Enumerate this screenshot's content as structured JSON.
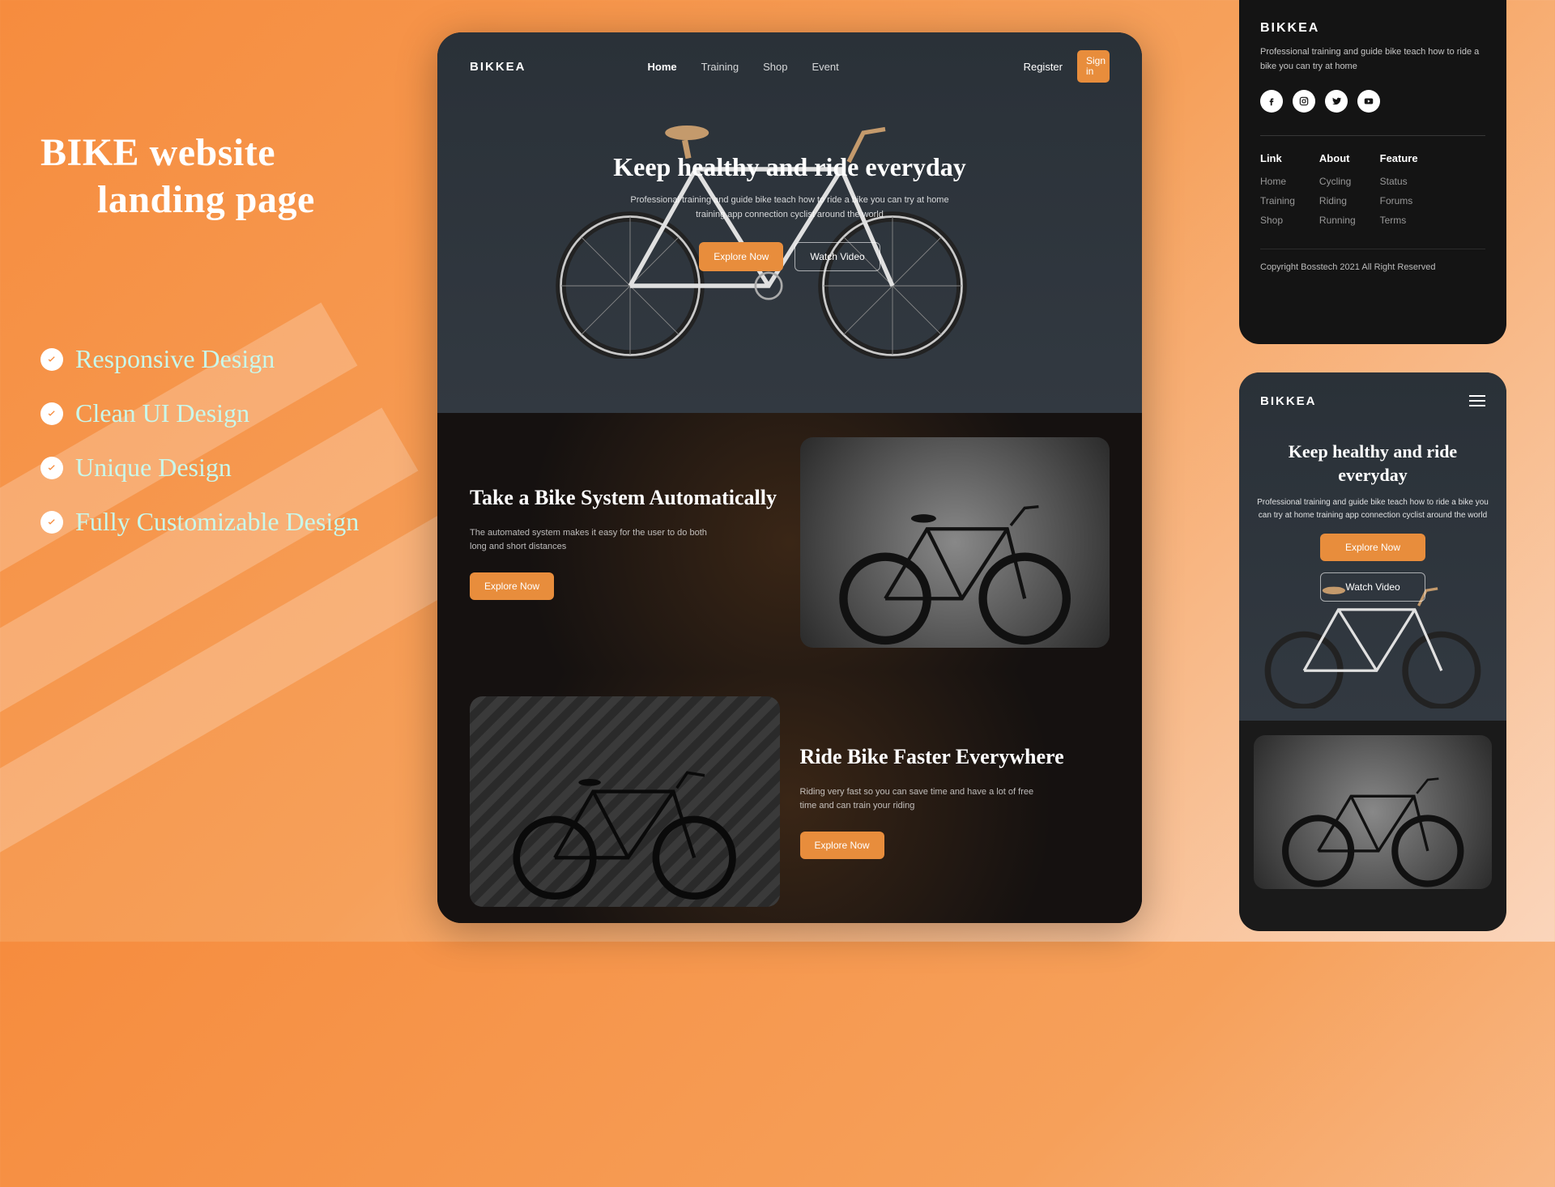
{
  "promo": {
    "title_line1": "BIKE website",
    "title_line2": "landing page",
    "features": [
      "Responsive Design",
      "Clean UI Design",
      "Unique Design",
      "Fully Customizable Design"
    ]
  },
  "desktop": {
    "brand": "BIKKEA",
    "nav": [
      "Home",
      "Training",
      "Shop",
      "Event"
    ],
    "nav_active": "Home",
    "register": "Register",
    "signin": "Sign in",
    "hero": {
      "title": "Keep healthy and ride everyday",
      "sub1": "Professional training and guide bike teach how to ride a bike you can  try at home",
      "sub2": "training app connection cyclist around the world",
      "cta_primary": "Explore Now",
      "cta_secondary": "Watch Video"
    },
    "section1": {
      "title": "Take a Bike System Automatically",
      "desc": "The automated system makes it easy for the user to do both long and short distances",
      "cta": "Explore Now"
    },
    "section2": {
      "title": "Ride Bike Faster Everywhere",
      "desc": "Riding very fast so you can save time and have a lot of free time and can train your riding",
      "cta": "Explore Now"
    }
  },
  "footer": {
    "brand": "BIKKEA",
    "desc": "Professional training and guide bike teach how to ride a bike you can  try at home",
    "socials": [
      "facebook",
      "instagram",
      "twitter",
      "youtube"
    ],
    "col1": {
      "title": "Link",
      "items": [
        "Home",
        "Training",
        "Shop"
      ]
    },
    "col2": {
      "title": "About",
      "items": [
        "Cycling",
        "Riding",
        "Running"
      ]
    },
    "col3": {
      "title": "Feature",
      "items": [
        "Status",
        "Forums",
        "Terms"
      ]
    },
    "copyright": "Copyright Bosstech 2021 All Right Reserved"
  },
  "mobile": {
    "brand": "BIKKEA",
    "hero_title": "Keep healthy and ride everyday",
    "hero_sub": "Professional training and guide bike teach how to ride a bike you can  try at home training app connection cyclist around the world",
    "cta_primary": "Explore Now",
    "cta_secondary": "Watch Video"
  }
}
